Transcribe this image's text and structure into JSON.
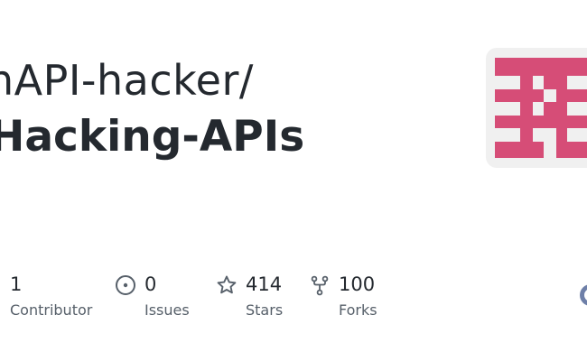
{
  "header": {
    "owner": "hAPI-hacker/",
    "repo": "Hacking-APIs"
  },
  "stats": [
    {
      "value": "1",
      "label": "Contributor",
      "icon": "contributor-icon"
    },
    {
      "value": "0",
      "label": "Issues",
      "icon": "issue-opened-icon"
    },
    {
      "value": "414",
      "label": "Stars",
      "icon": "star-icon"
    },
    {
      "value": "100",
      "label": "Forks",
      "icon": "repo-forked-icon"
    }
  ],
  "colors": {
    "text": "#24292f",
    "muted": "#57606a",
    "icon": "#57606a",
    "avatar_pink": "#d64d77",
    "avatar_bg": "#f0f0f0"
  }
}
